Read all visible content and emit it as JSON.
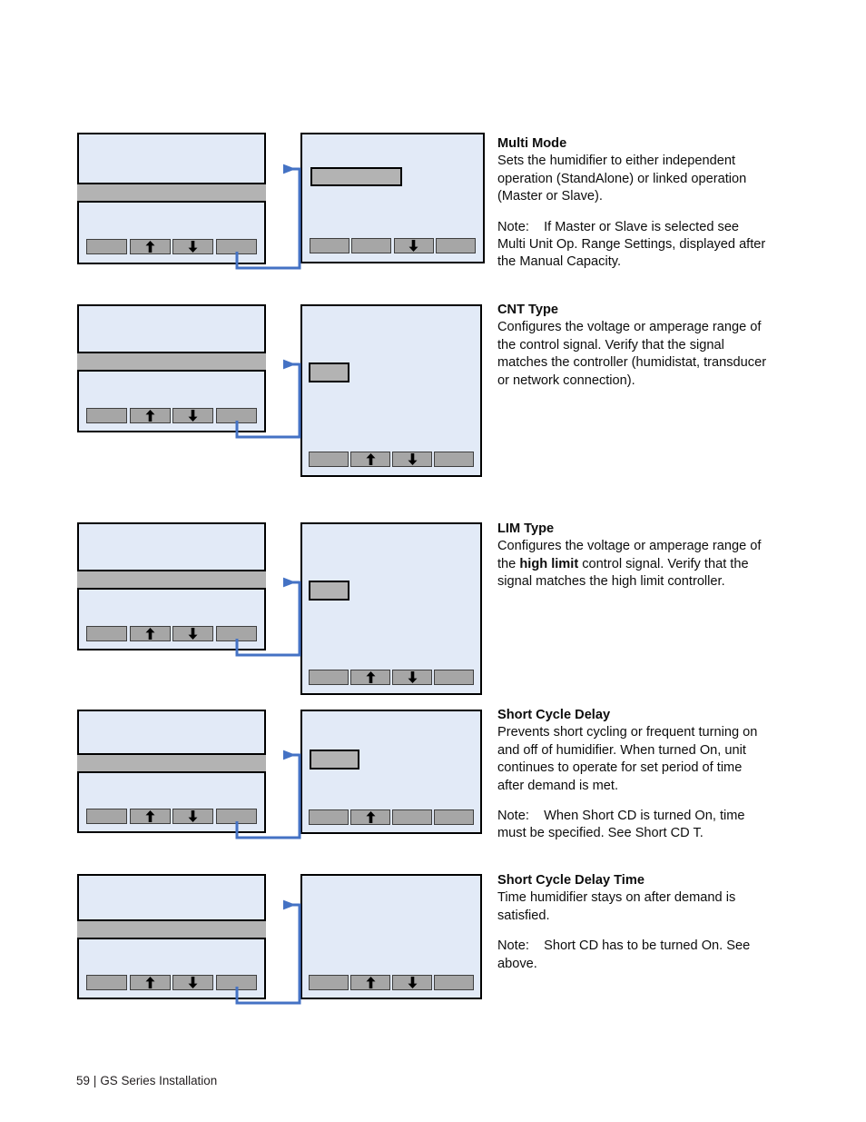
{
  "document": {
    "footer": {
      "page_number": "59",
      "separator": "|",
      "title": "GS Series Installation"
    }
  },
  "colors": {
    "lcd_background": "#e2eaf7",
    "lcd_border": "#000000",
    "highlight_grey": "#b3b3b3",
    "softkey_grey": "#a6a6a6",
    "connector_blue": "#4472c4"
  },
  "sections": [
    {
      "id": "multi-mode",
      "heading": "Multi Mode",
      "body": "Sets the humidifier to either independent operation (StandAlone) or linked operation (Master or Slave).",
      "note_label": "Note:",
      "note": "If Master or Slave is selected see Multi Unit Op. Range Settings, displayed after the Manual Capacity.",
      "source_screen": {
        "name": "menu-screen",
        "highlight_row": true,
        "softkeys": [
          "blank",
          "up-arrow",
          "down-arrow",
          "blank"
        ]
      },
      "target_screen": {
        "name": "setting-screen",
        "value_chip": true,
        "softkeys": [
          "blank",
          "blank",
          "down-arrow",
          "blank"
        ]
      }
    },
    {
      "id": "cnt-type",
      "heading": "CNT Type",
      "body": "Configures the voltage or amperage range of the control signal.  Verify that the signal matches the controller (humidistat, transducer or network connection).",
      "note_label": "",
      "note": "",
      "source_screen": {
        "name": "menu-screen",
        "highlight_row": true,
        "softkeys": [
          "blank",
          "up-arrow",
          "down-arrow",
          "blank"
        ]
      },
      "target_screen": {
        "name": "setting-screen",
        "value_chip": true,
        "softkeys": [
          "blank",
          "up-arrow",
          "down-arrow",
          "blank"
        ]
      }
    },
    {
      "id": "lim-type",
      "heading": "LIM Type",
      "body_before_bold": "Configures the voltage or amperage range of the ",
      "body_bold": "high limit",
      "body_after_bold": " control signal. Verify that the signal matches the high limit controller.",
      "note_label": "",
      "note": "",
      "source_screen": {
        "name": "menu-screen",
        "highlight_row": true,
        "softkeys": [
          "blank",
          "up-arrow",
          "down-arrow",
          "blank"
        ]
      },
      "target_screen": {
        "name": "setting-screen",
        "value_chip": true,
        "softkeys": [
          "blank",
          "up-arrow",
          "down-arrow",
          "blank"
        ]
      }
    },
    {
      "id": "short-cycle-delay",
      "heading": "Short Cycle Delay",
      "body": "Prevents short cycling or frequent turning on and off of humidifier.  When turned On, unit continues to operate for set period of time after demand is met.",
      "note_label": "Note:",
      "note": "When Short CD is turned On, time must be specified. See Short CD T.",
      "source_screen": {
        "name": "menu-screen",
        "highlight_row": true,
        "softkeys": [
          "blank",
          "up-arrow",
          "down-arrow",
          "blank"
        ]
      },
      "target_screen": {
        "name": "setting-screen",
        "value_chip": true,
        "softkeys": [
          "blank",
          "up-arrow",
          "blank",
          "blank"
        ]
      }
    },
    {
      "id": "short-cycle-delay-time",
      "heading": "Short Cycle Delay Time",
      "body": "Time humidifier stays on after demand is satisfied.",
      "note_label": "Note:",
      "note": "Short CD has to be turned On. See above.",
      "source_screen": {
        "name": "menu-screen",
        "highlight_row": true,
        "softkeys": [
          "blank",
          "up-arrow",
          "down-arrow",
          "blank"
        ]
      },
      "target_screen": {
        "name": "setting-screen",
        "value_chip": false,
        "softkeys": [
          "blank",
          "up-arrow",
          "down-arrow",
          "blank"
        ]
      }
    }
  ]
}
